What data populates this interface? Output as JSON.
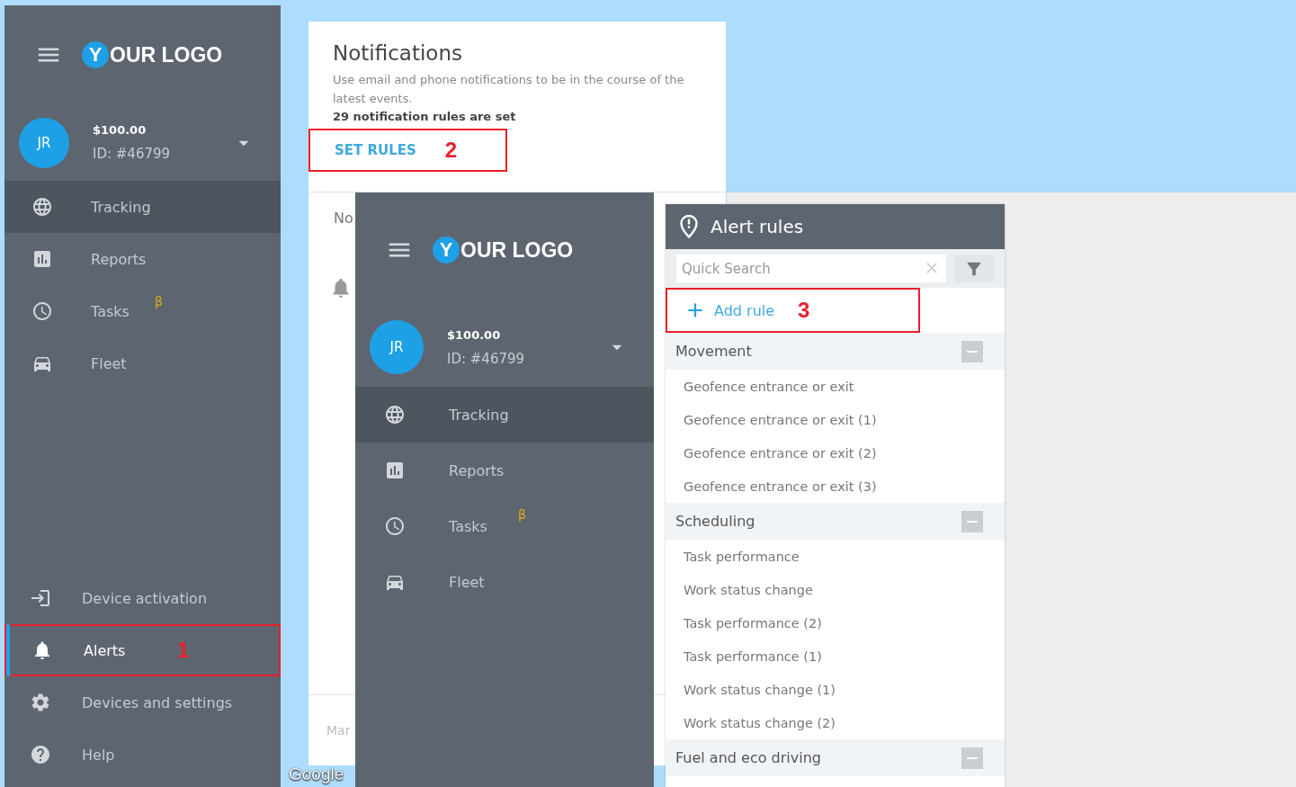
{
  "main_sidebar": {
    "logo_mark": "Y",
    "logo_text": "OUR LOGO",
    "avatar": "JR",
    "balance": "$100.00",
    "account_id": "ID: #46799",
    "nav_items": [
      {
        "label": "Tracking",
        "highlighted": true,
        "selected": false
      },
      {
        "label": "Reports",
        "highlighted": false,
        "selected": false
      },
      {
        "label": "Tasks",
        "highlighted": false,
        "selected": false,
        "badge": "β"
      },
      {
        "label": "Fleet",
        "highlighted": false,
        "selected": false
      }
    ],
    "bottom_items": [
      {
        "label": "Device activation",
        "highlighted": false,
        "selected": false
      },
      {
        "label": "Alerts",
        "highlighted": false,
        "selected": true,
        "callout": "1"
      },
      {
        "label": "Devices and settings",
        "highlighted": false,
        "selected": false
      },
      {
        "label": "Help",
        "highlighted": false,
        "selected": false
      }
    ]
  },
  "notifications": {
    "title": "Notifications",
    "description": "Use email and phone notifications to be in the course of the latest events.",
    "rules_count": "29 notification rules are set",
    "set_rules": "SET RULES",
    "callout": "2",
    "section_heading": "No",
    "footer_text": "Mar",
    "map_credit": "Google"
  },
  "overlay_sidebar": {
    "logo_mark": "Y",
    "logo_text": "OUR LOGO",
    "avatar": "JR",
    "balance": "$100.00",
    "account_id": "ID: #46799",
    "nav_items": [
      {
        "label": "Tracking",
        "highlighted": true,
        "selected": false
      },
      {
        "label": "Reports",
        "highlighted": false,
        "selected": false
      },
      {
        "label": "Tasks",
        "highlighted": false,
        "selected": false,
        "badge": "β"
      },
      {
        "label": "Fleet",
        "highlighted": false,
        "selected": false
      }
    ]
  },
  "alert_rules": {
    "title": "Alert rules",
    "search_placeholder": "Quick Search",
    "add_rule": "Add rule",
    "callout": "3",
    "groups": [
      {
        "name": "Movement",
        "expanded": true,
        "rules": [
          "Geofence entrance or exit",
          "Geofence entrance or exit (1)",
          "Geofence entrance or exit (2)",
          "Geofence entrance or exit (3)"
        ]
      },
      {
        "name": "Scheduling",
        "expanded": true,
        "rules": [
          "Task performance",
          "Work status change",
          "Task performance (2)",
          "Task performance (1)",
          "Work status change (1)",
          "Work status change (2)"
        ]
      },
      {
        "name": "Fuel and eco driving",
        "expanded": true
      }
    ]
  }
}
